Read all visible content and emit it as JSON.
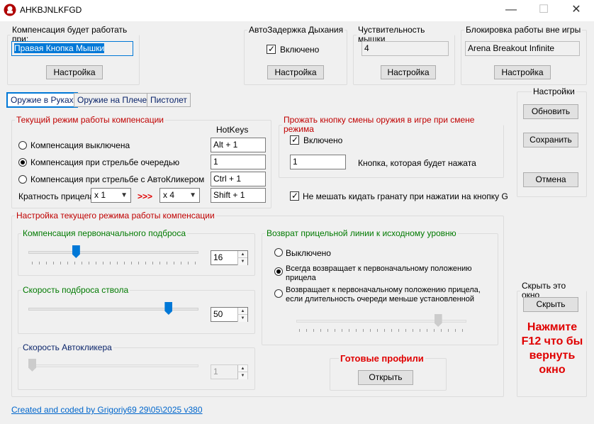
{
  "window": {
    "title": "AHKBJNLKFGD",
    "minimize": "—",
    "maximize": "☐",
    "close": "✕"
  },
  "compensation_group": {
    "legend": "Компенсация будет работать при:",
    "value": "Правая Кнопка Мышки",
    "button": "Настройка"
  },
  "breath_group": {
    "legend": "АвтоЗадержка Дыхания",
    "checkbox_label": "Включено",
    "checked": true,
    "button": "Настройка"
  },
  "sensitivity_group": {
    "legend": "Чуствительность мышки",
    "value": "4",
    "button": "Настройка"
  },
  "block_group": {
    "legend": "Блокировка работы вне игры",
    "value": "Arena Breakout Infinite",
    "button": "Настройка"
  },
  "tabs": [
    {
      "label": "Оружие в Руках",
      "active": true
    },
    {
      "label": "Оружие на Плече",
      "active": false
    },
    {
      "label": "Пистолет",
      "active": false
    }
  ],
  "mode_group": {
    "legend": "Текущий режим работы компенсации",
    "hotkeys_header": "HotKeys",
    "options": [
      {
        "label": "Компенсация выключена",
        "selected": false,
        "hotkey": "Alt + 1"
      },
      {
        "label": "Компенсация при стрельбе очередью",
        "selected": true,
        "hotkey": "1"
      },
      {
        "label": "Компенсация при стрельбе с АвтоКликером",
        "selected": false,
        "hotkey": "Ctrl + 1"
      }
    ],
    "scope_label": "Кратность прицела",
    "scope_from": "x 1",
    "scope_arrows": ">>>",
    "scope_to": "x 4",
    "scope_hotkey": "Shift + 1"
  },
  "switch_group": {
    "legend": "Прожать кнопку смены оружия в игре при смене режима",
    "checkbox_label": "Включено",
    "checked": true,
    "key_value": "1",
    "key_label": "Кнопка, которая будет нажата"
  },
  "grenade": {
    "label": "Не мешать кидать гранату при нажатии на кнопку G",
    "checked": true
  },
  "settings_group": {
    "legend": "Настройки",
    "refresh": "Обновить",
    "save": "Сохранить",
    "cancel": "Отмена"
  },
  "tuning_group": {
    "legend": "Настройка текущего режима работы компенсации",
    "initial_recoil": {
      "legend": "Компенсация первоначального подброса",
      "value": "16",
      "level": 0.27
    },
    "barrel_speed": {
      "legend": "Скорость подброса ствола",
      "value": "50",
      "level": 0.84
    },
    "autoclicker": {
      "legend": "Скорость Автокликера",
      "value": "1",
      "level": 0.0
    },
    "return_group": {
      "legend": "Возврат прицельной линии к исходному уровню",
      "options": [
        {
          "label": "Выключено",
          "selected": false
        },
        {
          "label": "Всегда возвращает к первоначальному положению прицела",
          "selected": true
        },
        {
          "label": "Возвращает к первоначальному положению прицела, если длительность очереди меньше установленной",
          "selected": false
        }
      ],
      "level": 0.85
    },
    "profiles": {
      "legend": "Готовые профили",
      "button": "Открыть"
    }
  },
  "hide_group": {
    "legend": "Скрыть это окно",
    "button": "Скрыть",
    "hint": "Нажмите F12 что бы вернуть окно"
  },
  "footer": {
    "credit": "Created and coded by Grigoriy69 29\\05\\2025 v380"
  },
  "colors": {
    "accent": "#0078d7",
    "legend_red": "#c00000",
    "legend_green": "#007a00",
    "hint_red": "#e00000"
  }
}
